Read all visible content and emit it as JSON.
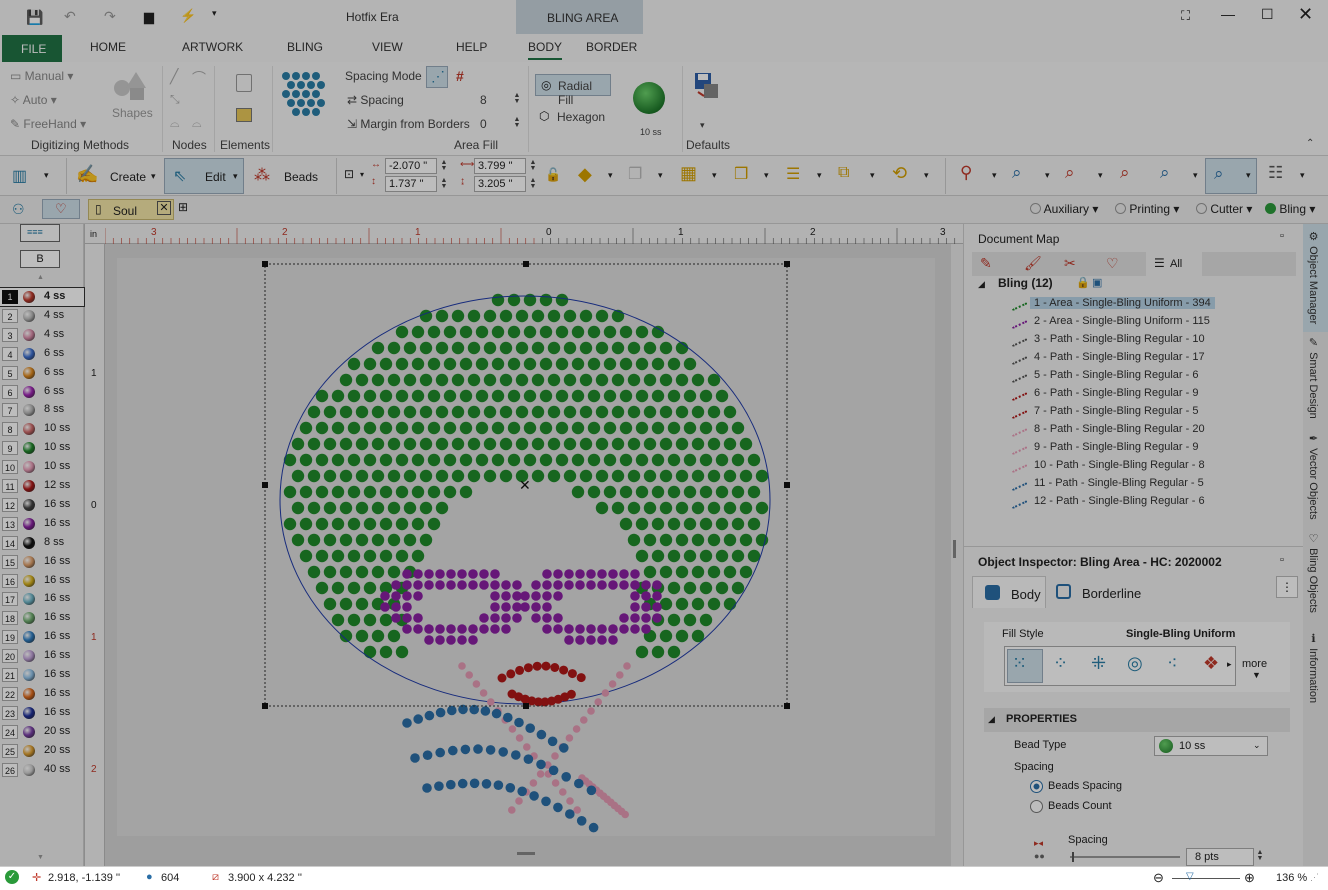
{
  "window": {
    "title": "Hotfix Era",
    "context_tab": "BLING AREA"
  },
  "ribbon_tabs": [
    "FILE",
    "HOME",
    "ARTWORK",
    "BLING",
    "VIEW",
    "HELP",
    "BODY",
    "BORDER"
  ],
  "ribbon": {
    "digitizing": {
      "manual": "Manual",
      "auto": "Auto",
      "freehand": "FreeHand",
      "shapes": "Shapes",
      "label": "Digitizing Methods"
    },
    "nodes_label": "Nodes",
    "elements_label": "Elements",
    "area_fill": {
      "spacing_mode": "Spacing Mode",
      "spacing": "Spacing",
      "spacing_value": "8",
      "margin": "Margin from Borders",
      "margin_value": "0",
      "label": "Area Fill"
    },
    "radial_fill": "Radial Fill",
    "hexagon": "Hexagon",
    "bead_size": "10 ss",
    "defaults_label": "Defaults"
  },
  "toolbar2": {
    "create": "Create",
    "edit": "Edit",
    "beads": "Beads",
    "x": "-2.070 \"",
    "y": "1.737 \"",
    "w": "3.799 \"",
    "h": "3.205 \""
  },
  "toolbar3": {
    "doc_tab": "Soul",
    "modes": [
      "Auxiliary",
      "Printing",
      "Cutter",
      "Bling"
    ]
  },
  "palette": {
    "header_btn": "B",
    "items": [
      {
        "n": "1",
        "size": "4 ss",
        "color": "#c0392b"
      },
      {
        "n": "2",
        "size": "4 ss",
        "color": "#b9b9b9"
      },
      {
        "n": "3",
        "size": "4 ss",
        "color": "#d98aa8"
      },
      {
        "n": "4",
        "size": "6 ss",
        "color": "#3b6fd1"
      },
      {
        "n": "5",
        "size": "6 ss",
        "color": "#e08a1e"
      },
      {
        "n": "6",
        "size": "6 ss",
        "color": "#a025b5"
      },
      {
        "n": "7",
        "size": "8 ss",
        "color": "#b5b5b5"
      },
      {
        "n": "8",
        "size": "10 ss",
        "color": "#cf6a6a"
      },
      {
        "n": "9",
        "size": "10 ss",
        "color": "#1f8a2b"
      },
      {
        "n": "10",
        "size": "10 ss",
        "color": "#e79bb6"
      },
      {
        "n": "11",
        "size": "12 ss",
        "color": "#b01818"
      },
      {
        "n": "12",
        "size": "16 ss",
        "color": "#444444"
      },
      {
        "n": "13",
        "size": "16 ss",
        "color": "#8a1fa3"
      },
      {
        "n": "14",
        "size": "8 ss",
        "color": "#111111"
      },
      {
        "n": "15",
        "size": "16 ss",
        "color": "#e0a06a"
      },
      {
        "n": "16",
        "size": "16 ss",
        "color": "#d8b21a"
      },
      {
        "n": "17",
        "size": "16 ss",
        "color": "#6fb7c9"
      },
      {
        "n": "18",
        "size": "16 ss",
        "color": "#6fae6f"
      },
      {
        "n": "19",
        "size": "16 ss",
        "color": "#2f7fc4"
      },
      {
        "n": "20",
        "size": "16 ss",
        "color": "#c0a0d8"
      },
      {
        "n": "21",
        "size": "16 ss",
        "color": "#8fc1e8"
      },
      {
        "n": "22",
        "size": "16 ss",
        "color": "#e06a1a"
      },
      {
        "n": "23",
        "size": "16 ss",
        "color": "#1d2f9a"
      },
      {
        "n": "24",
        "size": "20 ss",
        "color": "#7a3fa8"
      },
      {
        "n": "25",
        "size": "20 ss",
        "color": "#e0a030"
      },
      {
        "n": "26",
        "size": "40 ss",
        "color": "#cfcfcf"
      }
    ]
  },
  "document_map": {
    "title": "Document Map",
    "all_label": "All",
    "root": "Bling (12)",
    "items": [
      {
        "label": "1 - Area - Single-Bling Uniform - 394",
        "color": "#1f8a2b"
      },
      {
        "label": "2 - Area - Single-Bling Uniform - 115",
        "color": "#8a1fa3"
      },
      {
        "label": "3 - Path - Single-Bling Regular - 10",
        "color": "#555"
      },
      {
        "label": "4 - Path - Single-Bling Regular - 17",
        "color": "#555"
      },
      {
        "label": "5 - Path - Single-Bling Regular - 6",
        "color": "#555"
      },
      {
        "label": "6 - Path - Single-Bling Regular - 9",
        "color": "#b01818"
      },
      {
        "label": "7 - Path - Single-Bling Regular - 5",
        "color": "#b01818"
      },
      {
        "label": "8 - Path - Single-Bling Regular - 20",
        "color": "#e79bb6"
      },
      {
        "label": "9 - Path - Single-Bling Regular - 9",
        "color": "#e79bb6"
      },
      {
        "label": "10 - Path - Single-Bling Regular - 8",
        "color": "#e79bb6"
      },
      {
        "label": "11 - Path - Single-Bling Regular - 5",
        "color": "#2f6fa8"
      },
      {
        "label": "12 - Path - Single-Bling Regular - 6",
        "color": "#2f6fa8"
      }
    ]
  },
  "inspector": {
    "title": "Object Inspector: Bling Area - HC: 2020002",
    "tab_body": "Body",
    "tab_border": "Borderline",
    "fill_style_label": "Fill Style",
    "fill_style_value": "Single-Bling Uniform",
    "more": "more",
    "properties": "PROPERTIES",
    "bead_type_label": "Bead Type",
    "bead_type_value": "10 ss",
    "spacing_label": "Spacing",
    "beads_spacing": "Beads Spacing",
    "beads_count": "Beads Count",
    "spacing_sub": "Spacing",
    "spacing_pts": "8 pts"
  },
  "side_tabs": [
    "Object Manager",
    "Smart Design",
    "Vector Objects",
    "Bling Objects",
    "Information"
  ],
  "ruler": {
    "unit": "in",
    "h_labels": [
      "3",
      "2",
      "1",
      "0",
      "1",
      "2",
      "3"
    ],
    "v_labels": [
      "1",
      "0",
      "1",
      "2"
    ]
  },
  "status": {
    "coords": "2.918, -1.139 ''",
    "count": "604",
    "size": "3.900 x 4.232 ''",
    "zoom": "136 %"
  },
  "colors": {
    "green": "#1f8a2b",
    "purple": "#8a1fa3",
    "red": "#b01818",
    "pink": "#e59ab4",
    "blue": "#2a6ea6",
    "accent": "#217346"
  }
}
